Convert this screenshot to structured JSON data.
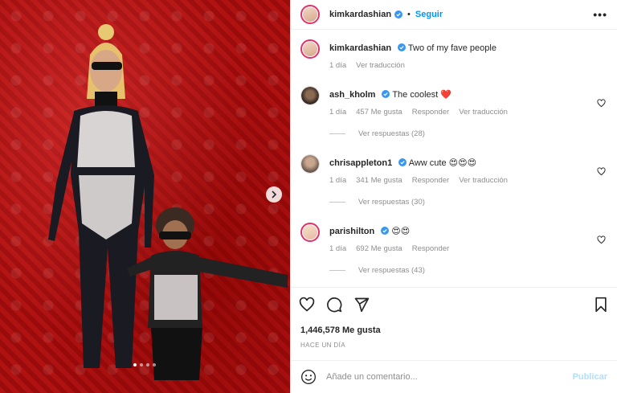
{
  "post": {
    "author": "kimkardashian",
    "follow_label": "Seguir",
    "separator": "•",
    "more_label": "•••",
    "caption": "Two of my fave people",
    "caption_time": "1 día",
    "caption_translate": "Ver traducción",
    "likes": "1,446,578 Me gusta",
    "date": "HACE UN DÍA",
    "carousel": {
      "slides": 4,
      "active": 1
    }
  },
  "comments": [
    {
      "user": "ash_kholm",
      "text": "The coolest ❤️",
      "time": "1 día",
      "likes": "457 Me gusta",
      "reply": "Responder",
      "translate": "Ver traducción",
      "replies": "Ver respuestas (28)"
    },
    {
      "user": "chrisappleton1",
      "text": "Aww cute 😍😍😍",
      "time": "1 día",
      "likes": "341 Me gusta",
      "reply": "Responder",
      "translate": "Ver traducción",
      "replies": "Ver respuestas (30)"
    },
    {
      "user": "parishilton",
      "text": "😍😍",
      "time": "1 día",
      "likes": "692 Me gusta",
      "reply": "Responder",
      "replies": "Ver respuestas (43)"
    }
  ],
  "composer": {
    "placeholder": "Añade un comentario...",
    "publish_label": "Publicar"
  },
  "colors": {
    "accent": "#0095f6",
    "publish_disabled": "#b2dffc",
    "verified": "#3897f0",
    "heart_red": "#ed4956",
    "muted": "#8e8e8e"
  },
  "icons": [
    "next-arrow-icon",
    "verified-badge-icon",
    "heart-icon",
    "comment-icon",
    "share-icon",
    "bookmark-icon",
    "emoji-icon"
  ]
}
